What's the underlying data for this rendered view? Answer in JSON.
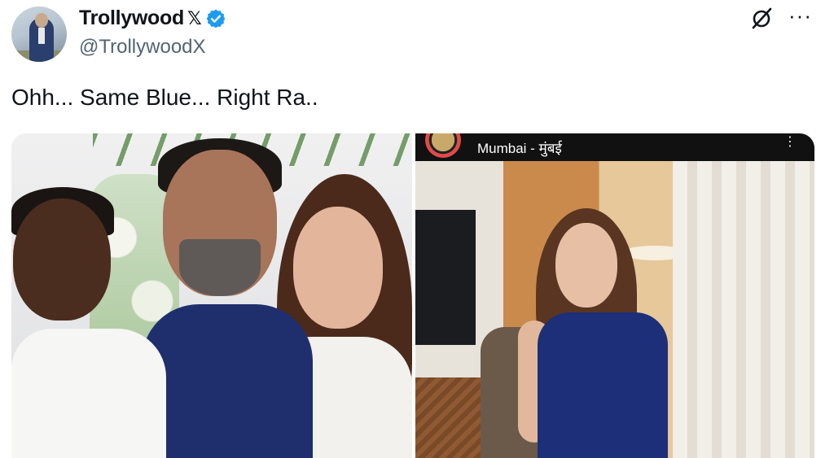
{
  "author": {
    "display_name": "Trollywood",
    "name_badge": "𝕏",
    "handle": "@TrollywoodX",
    "verified": true,
    "verified_color": "#1d9bf0"
  },
  "header_actions": {
    "grok_icon": "grok-icon",
    "more_label": "···"
  },
  "tweet": {
    "text": "Ohh... Same Blue... Right Ra.."
  },
  "media": {
    "photo_right": {
      "location_label": "Mumbai - मुंबई",
      "menu_label": "⋮"
    }
  },
  "colors": {
    "text_primary": "#0f1419",
    "text_secondary": "#536471",
    "accent": "#1d9bf0"
  }
}
